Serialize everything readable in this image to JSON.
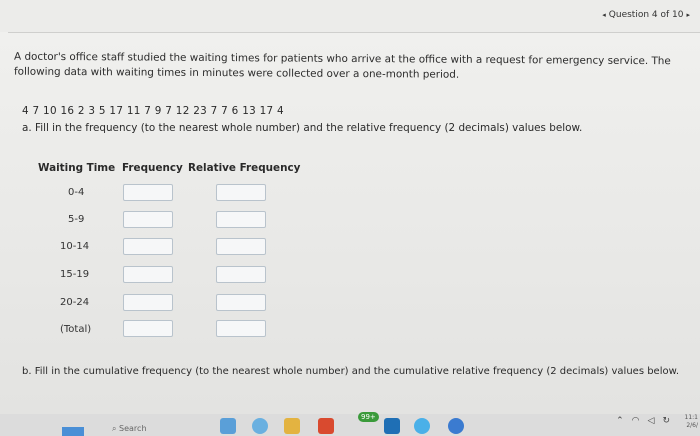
{
  "header": {
    "prev_arrow": "◂",
    "question_label": "Question 4 of 10",
    "next_arrow": "▸"
  },
  "problem": {
    "prompt": "A doctor's office staff studied the waiting times for patients who arrive at the office with a request for emergency service. The following data with waiting times in minutes were collected over a one-month period.",
    "data_values": "4 7 10 16 2 3 5 17 11 7 9 7 12 23 7 7 6 13 17 4",
    "part_a": "a. Fill in the frequency (to the nearest whole number) and the relative frequency (2 decimals) values below.",
    "part_b": "b. Fill in the cumulative frequency (to the nearest whole number) and the cumulative relative frequency (2 decimals) values below."
  },
  "table": {
    "headers": [
      "Waiting Time",
      "Frequency",
      "Relative Frequency"
    ],
    "rows": [
      {
        "label": "0-4",
        "frequency": "",
        "relative_frequency": ""
      },
      {
        "label": "5-9",
        "frequency": "",
        "relative_frequency": ""
      },
      {
        "label": "10-14",
        "frequency": "",
        "relative_frequency": ""
      },
      {
        "label": "15-19",
        "frequency": "",
        "relative_frequency": ""
      },
      {
        "label": "20-24",
        "frequency": "",
        "relative_frequency": ""
      },
      {
        "label": "(Total)",
        "frequency": "",
        "relative_frequency": ""
      }
    ]
  },
  "taskbar": {
    "search_label": "Search",
    "badge": "99+",
    "tray_icons": [
      "chevron-up-icon",
      "wifi-icon",
      "speaker-icon",
      "sync-icon"
    ],
    "clock_time": "11:1",
    "clock_date": "2/6/"
  },
  "colors": {
    "input_border": "#b9c3cc",
    "page_background": "#ececea",
    "start_blue": "#4a8fd6"
  }
}
